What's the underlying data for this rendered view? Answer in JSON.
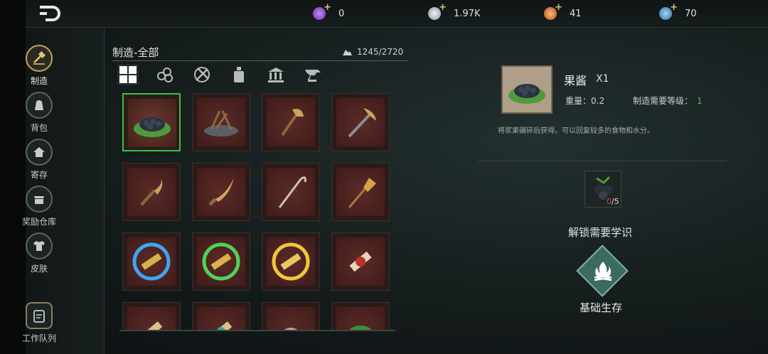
{
  "currencies": [
    {
      "name": "purple-gem-icon",
      "value": "0",
      "color": "#8e4fd3"
    },
    {
      "name": "silver-coin-icon",
      "value": "1.97K",
      "color": "#bfc6cf"
    },
    {
      "name": "orange-token-icon",
      "value": "41",
      "color": "#e07a2e"
    },
    {
      "name": "blue-crystal-icon",
      "value": "70",
      "color": "#4d9fd6"
    }
  ],
  "sidebar": {
    "items": [
      {
        "label": "制造",
        "icon": "hammer-icon",
        "active": true
      },
      {
        "label": "背包",
        "icon": "bag-icon",
        "active": false
      },
      {
        "label": "寄存",
        "icon": "house-icon",
        "active": false
      },
      {
        "label": "奖励仓库",
        "icon": "shop-icon",
        "active": false
      },
      {
        "label": "皮肤",
        "icon": "shirt-icon",
        "active": false
      }
    ],
    "queue_label": "工作队列"
  },
  "panel": {
    "title": "制造-全部",
    "capacity": "1245/2720",
    "filters": [
      "all-grid-icon",
      "logs-icon",
      "tools-icon",
      "bottle-icon",
      "building-icon",
      "anvil-icon"
    ]
  },
  "items": [
    {
      "name": "blackberry-jam-item"
    },
    {
      "name": "campfire-item"
    },
    {
      "name": "axe-item"
    },
    {
      "name": "pickaxe-item"
    },
    {
      "name": "sickle-item"
    },
    {
      "name": "knife-item"
    },
    {
      "name": "hook-pole-item"
    },
    {
      "name": "shovel-item"
    },
    {
      "name": "blue-rune-scroll-item"
    },
    {
      "name": "green-rune-scroll-item"
    },
    {
      "name": "gold-rune-scroll-item"
    },
    {
      "name": "red-scroll-item"
    },
    {
      "name": "scroll-item-partial-1"
    },
    {
      "name": "scroll-item-partial-2"
    },
    {
      "name": "sand-pile-item"
    },
    {
      "name": "herb-item"
    }
  ],
  "detail": {
    "name": "果酱",
    "qty": "X1",
    "weight": "重量：0.2",
    "level_label": "制造需要等级：",
    "level_value": "1",
    "description": "将浆果碾碎后获得。可以回复较多的食物和水分。",
    "material_have": "0",
    "material_need": "/5",
    "unlock_label": "解锁需要学识",
    "skill_label": "基础生存"
  }
}
